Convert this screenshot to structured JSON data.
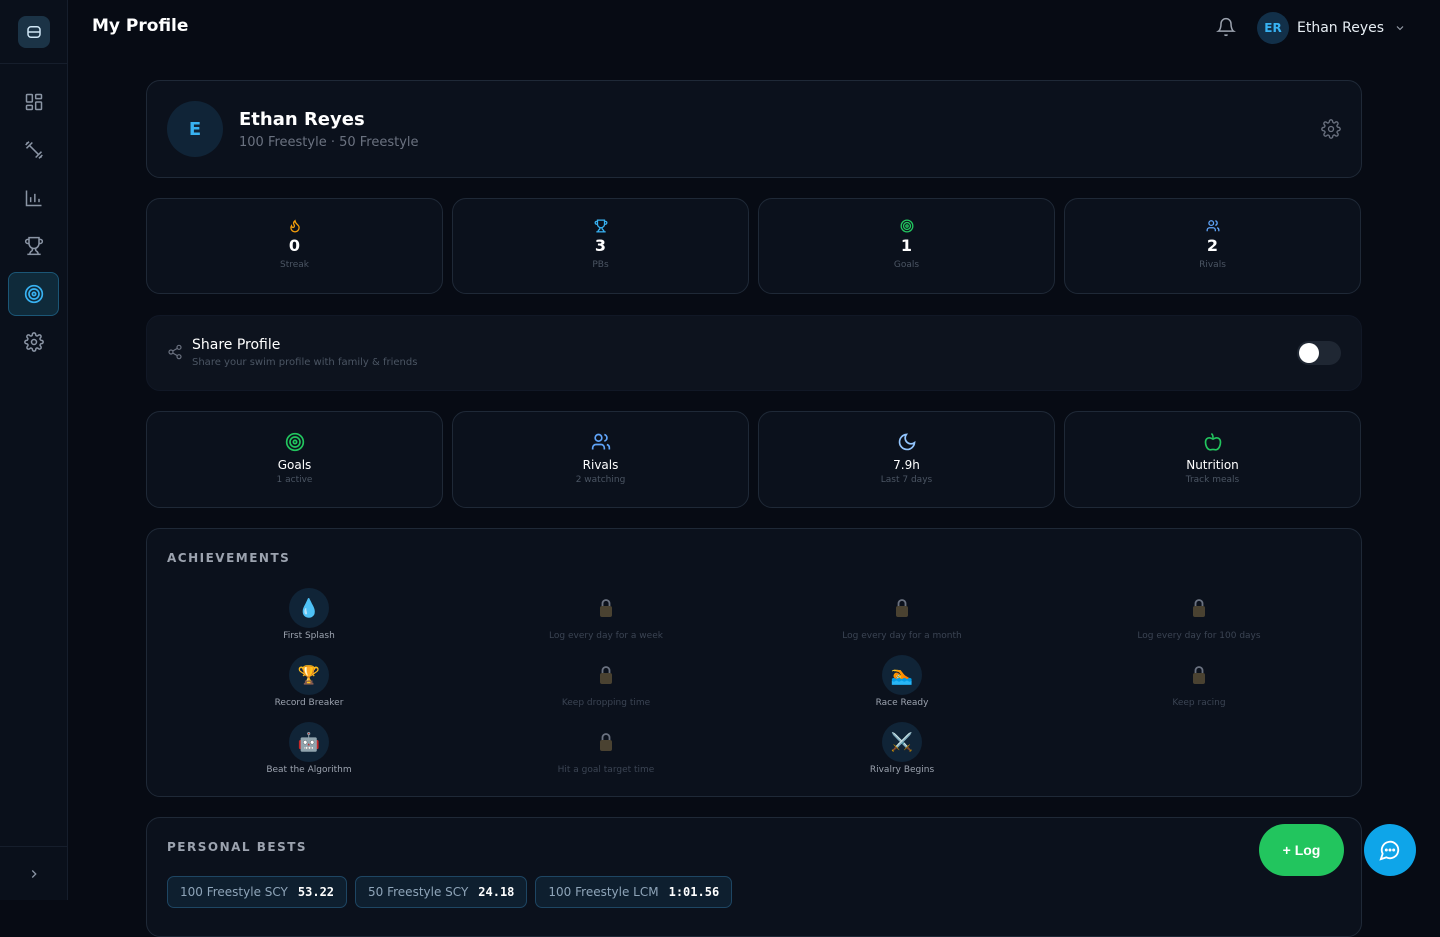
{
  "header": {
    "title": "My Profile",
    "user_initials": "ER",
    "user_name": "Ethan Reyes"
  },
  "sidebar": {
    "items": [
      "dashboard-icon",
      "workouts-icon",
      "stats-icon",
      "trophy-icon",
      "target-icon",
      "settings-icon"
    ],
    "active": "target-icon"
  },
  "profile": {
    "initial": "E",
    "name": "Ethan Reyes",
    "events": "100 Freestyle · 50 Freestyle"
  },
  "stats": [
    {
      "icon": "flame-icon",
      "value": "0",
      "label": "Streak",
      "color": "#f59e0b"
    },
    {
      "icon": "trophy-icon",
      "value": "3",
      "label": "PBs",
      "color": "#38b2f2"
    },
    {
      "icon": "target-icon",
      "value": "1",
      "label": "Goals",
      "color": "#22c55e"
    },
    {
      "icon": "users-icon",
      "value": "2",
      "label": "Rivals",
      "color": "#60a5fa"
    }
  ],
  "share": {
    "title": "Share Profile",
    "subtitle": "Share your swim profile with family & friends",
    "enabled": false
  },
  "quick_links": [
    {
      "icon": "target-icon",
      "title": "Goals",
      "subtitle": "1 active",
      "color": "#22c55e"
    },
    {
      "icon": "users-icon",
      "title": "Rivals",
      "subtitle": "2 watching",
      "color": "#60a5fa"
    },
    {
      "icon": "moon-icon",
      "title": "7.9h",
      "subtitle": "Last 7 days",
      "color": "#93c5fd"
    },
    {
      "icon": "apple-icon",
      "title": "Nutrition",
      "subtitle": "Track meals",
      "color": "#22c55e"
    }
  ],
  "achievements": {
    "title": "ACHIEVEMENTS",
    "items": [
      {
        "label": "First Splash",
        "emoji": "💧",
        "locked": false
      },
      {
        "label": "Log every day for a week",
        "locked": true
      },
      {
        "label": "Log every day for a month",
        "locked": true
      },
      {
        "label": "Log every day for 100 days",
        "locked": true
      },
      {
        "label": "Record Breaker",
        "emoji": "🏆",
        "locked": false
      },
      {
        "label": "Keep dropping time",
        "locked": true
      },
      {
        "label": "Race Ready",
        "emoji": "🏊",
        "locked": false
      },
      {
        "label": "Keep racing",
        "locked": true
      },
      {
        "label": "Beat the Algorithm",
        "emoji": "🤖",
        "locked": false
      },
      {
        "label": "Hit a goal target time",
        "locked": true
      },
      {
        "label": "Rivalry Begins",
        "emoji": "⚔️",
        "locked": false
      }
    ]
  },
  "personal_bests": {
    "title": "PERSONAL BESTS",
    "items": [
      {
        "event": "100 Freestyle SCY",
        "time": "53.22"
      },
      {
        "event": "50 Freestyle SCY",
        "time": "24.18"
      },
      {
        "event": "100 Freestyle LCM",
        "time": "1:01.56"
      }
    ]
  },
  "actions": {
    "log_label": "+ Log"
  }
}
